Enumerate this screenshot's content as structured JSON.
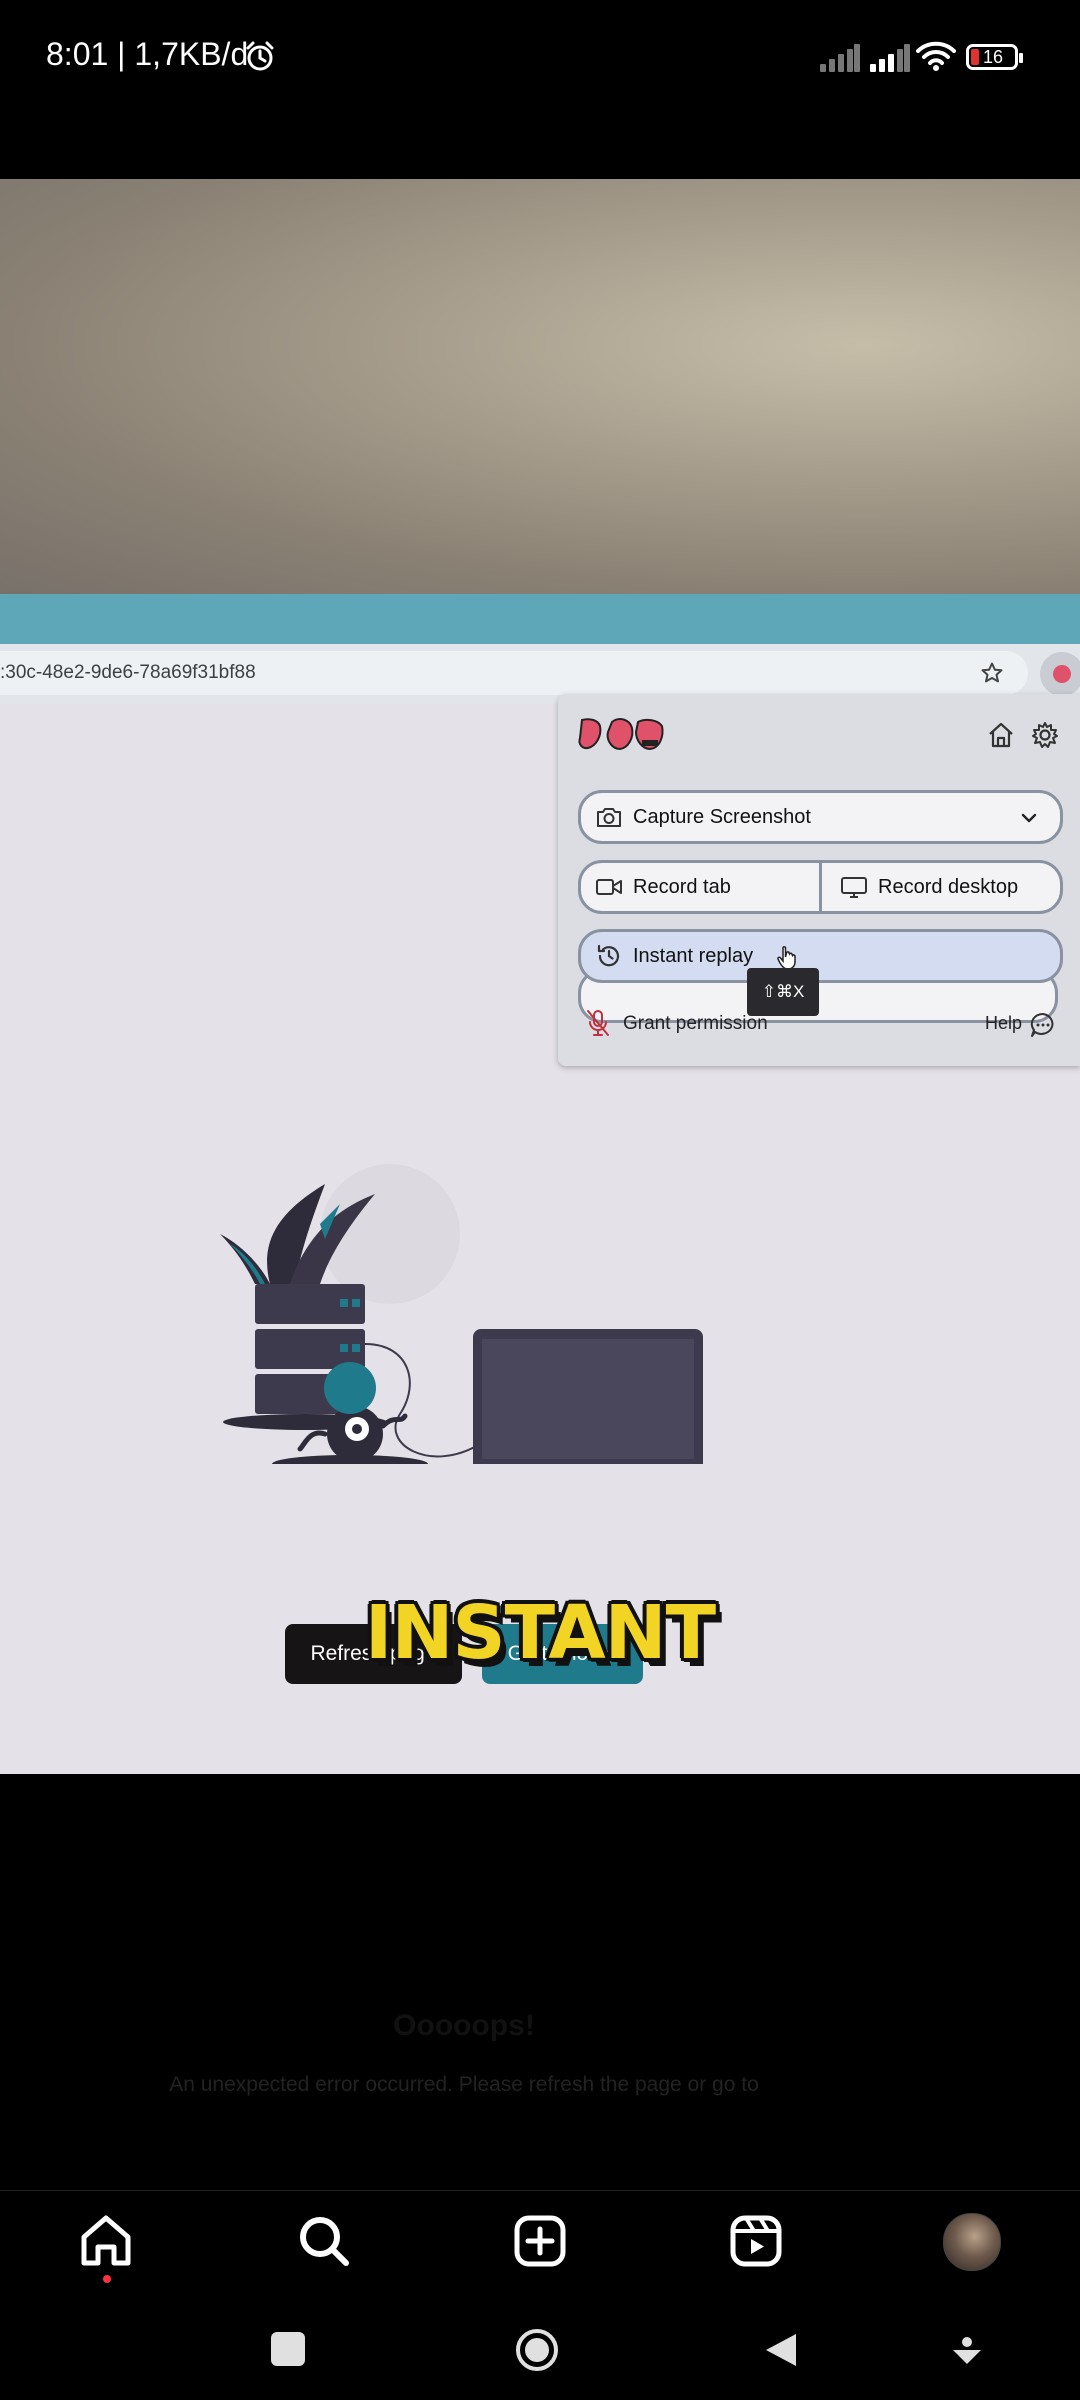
{
  "status_bar": {
    "time": "8:01",
    "network_speed": "1,7KB/d",
    "battery_level": "16",
    "icons": [
      "alarm-icon",
      "signal-icon",
      "signal-icon",
      "wifi-icon",
      "battery-icon"
    ]
  },
  "browser": {
    "url_fragment": ":30c-48e2-9de6-78a69f31bf88",
    "icons": [
      "star-icon",
      "extension-icon"
    ]
  },
  "extension_popup": {
    "capture_screenshot_label": "Capture Screenshot",
    "record_tab_label": "Record tab",
    "record_desktop_label": "Record desktop",
    "instant_replay_label": "Instant replay",
    "shortcut_tooltip": "⇧⌘X",
    "grant_permission_label": "Grant permission",
    "help_label": "Help",
    "icons": [
      "logo-icon",
      "home-icon",
      "gear-icon",
      "camera-icon",
      "chevron-down-icon",
      "video-icon",
      "monitor-icon",
      "history-icon",
      "mic-off-icon",
      "chat-icon",
      "cursor-icon"
    ]
  },
  "error_page": {
    "title": "Ooooops!",
    "message": "An unexpected error occurred. Please refresh the page or go to home.",
    "refresh_label": "Refresh page",
    "home_label": "Go to home"
  },
  "overlay_caption": "INSTANT",
  "bottom_nav": {
    "icons": [
      "home-icon",
      "search-icon",
      "create-icon",
      "reels-icon",
      "profile-avatar"
    ]
  },
  "system_nav": {
    "icons": [
      "recents-icon",
      "home-button-icon",
      "back-icon",
      "down-icon"
    ]
  },
  "colors": {
    "teal_accent": "#1f7a8c",
    "instant_yellow": "#f2d524",
    "popup_highlight": "#d3dcf0",
    "dark_button": "#171415"
  }
}
